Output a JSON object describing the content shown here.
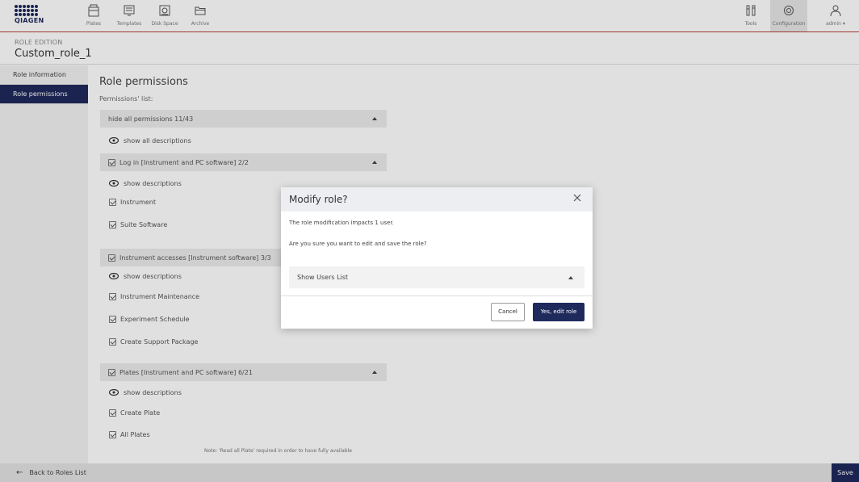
{
  "brand": {
    "logo_text": "QIAGEN"
  },
  "topnav": {
    "items": [
      {
        "label": "Plates",
        "icon": "plates-icon"
      },
      {
        "label": "Templates",
        "icon": "templates-icon"
      },
      {
        "label": "Disk Space",
        "icon": "disk-space-icon"
      },
      {
        "label": "Archive",
        "icon": "archive-icon"
      }
    ],
    "right_items": [
      {
        "label": "Tools",
        "icon": "tools-icon"
      },
      {
        "label": "Configuration",
        "icon": "gear-icon"
      },
      {
        "label": "admin ▾",
        "icon": "user-icon"
      }
    ]
  },
  "header": {
    "section": "ROLE EDITION",
    "role_name": "Custom_role_1"
  },
  "sidebar": {
    "items": [
      {
        "label": "Role information",
        "active": false
      },
      {
        "label": "Role permissions",
        "active": true
      }
    ]
  },
  "main": {
    "title": "Role permissions",
    "list_label": "Permissions' list:",
    "hide_all": "hide all permissions 11/43",
    "show_all_descriptions": "show all descriptions",
    "groups": [
      {
        "label": "Log in [Instrument and PC software] 2/2",
        "show_desc": "show descriptions",
        "items": [
          "Instrument",
          "Suite Software"
        ]
      },
      {
        "label": "Instrument accesses [Instrument software] 3/3",
        "show_desc": "show descriptions",
        "items": [
          "Instrument Maintenance",
          "Experiment Schedule",
          "Create Support Package"
        ]
      },
      {
        "label": "Plates [Instrument and PC software] 6/21",
        "show_desc": "show descriptions",
        "items": [
          "Create Plate",
          "All Plates"
        ]
      }
    ],
    "note": "Note: 'Read all Plate' required in order to have fully available"
  },
  "modal": {
    "title": "Modify role?",
    "line1": "The role modification impacts 1 user.",
    "line2": "Are you sure you want to edit and save the role?",
    "users_toggle": "Show Users List",
    "cancel": "Cancel",
    "confirm": "Yes, edit role"
  },
  "footer": {
    "back": "Back to Roles List",
    "save": "Save"
  },
  "colors": {
    "primary": "#1f2a5c",
    "accent_line": "#b5413a"
  }
}
